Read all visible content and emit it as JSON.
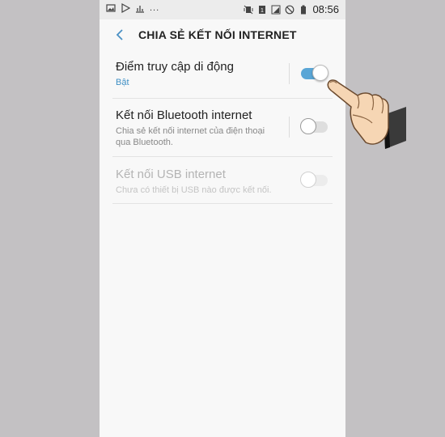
{
  "status_bar": {
    "left_icons": [
      "image-icon",
      "play-store-icon",
      "bar-chart-icon"
    ],
    "overflow": "...",
    "right_icons": [
      "vibrate-icon",
      "sim-icon",
      "signal-icon",
      "no-disturb-icon",
      "battery-icon"
    ],
    "time": "08:56"
  },
  "header": {
    "back_icon": "back-arrow-icon",
    "title": "CHIA SẺ KẾT NỐI INTERNET"
  },
  "settings": [
    {
      "title": "Điểm truy cập di động",
      "subtitle": "Bật",
      "enabled": true,
      "toggle_on": true
    },
    {
      "title": "Kết nối Bluetooth internet",
      "subtitle_line1": "Chia sẻ kết nối internet của điện thoại",
      "subtitle_line2": "qua Bluetooth.",
      "enabled": true,
      "toggle_on": false
    },
    {
      "title": "Kết nối USB internet",
      "subtitle": "Chưa có thiết bị USB nào được kết nối.",
      "enabled": false,
      "toggle_on": false
    }
  ],
  "colors": {
    "accent": "#5aa6d6",
    "subtitle_on": "#3f8fc4",
    "background": "#c3c1c3"
  },
  "overlay": {
    "icon": "pointing-hand-icon"
  }
}
